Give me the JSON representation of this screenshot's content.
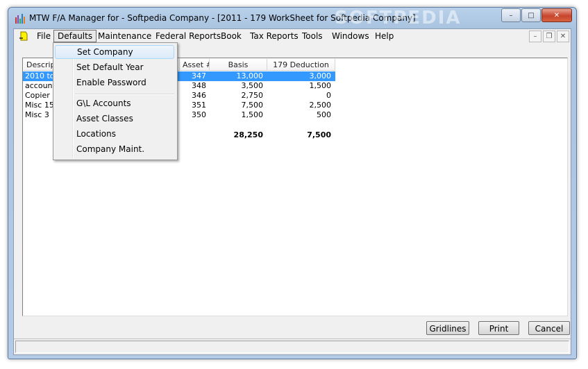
{
  "window": {
    "title": "MTW F/A Manager for - Softpedia Company - [2011 - 179 WorkSheet for Softpedia Company]",
    "watermark": "SOFTPEDIA",
    "minimize": "–",
    "maximize": "□",
    "close": "✕"
  },
  "menubar": {
    "items": [
      "File",
      "Defaults",
      "Maintenance",
      "Federal Reports",
      "Book",
      "Tax Reports",
      "Tools",
      "Windows",
      "Help"
    ],
    "active": "Defaults",
    "mdi_minimize": "–",
    "mdi_restore": "❐",
    "mdi_close": "✕"
  },
  "defaults_menu": {
    "items": [
      "Set Company",
      "Set Default Year",
      "Enable Password",
      "G\\L Accounts",
      "Asset Classes",
      "Locations",
      "Company Maint."
    ],
    "highlighted": "Set Company"
  },
  "table": {
    "columns": [
      "Descrip",
      "Asset #",
      "Basis",
      "179 Deduction"
    ],
    "rows": [
      {
        "description": "2010 to",
        "asset": "347",
        "basis": "13,000",
        "deduction": "3,000",
        "selected": true
      },
      {
        "description": "account",
        "asset": "348",
        "basis": "3,500",
        "deduction": "1,500",
        "selected": false
      },
      {
        "description": "Copier",
        "asset": "346",
        "basis": "2,750",
        "deduction": "0",
        "selected": false
      },
      {
        "description": "Misc 15",
        "asset": "351",
        "basis": "7,500",
        "deduction": "2,500",
        "selected": false
      },
      {
        "description": "Misc 3",
        "asset": "350",
        "basis": "1,500",
        "deduction": "500",
        "selected": false
      }
    ],
    "totals": {
      "basis": "28,250",
      "deduction": "7,500"
    }
  },
  "buttons": {
    "gridlines": "Gridlines",
    "print": "Print",
    "cancel": "Cancel"
  },
  "colors": {
    "selection": "#3399ff",
    "title_bar": "#b9d1ea",
    "close_button": "#c8442c"
  }
}
